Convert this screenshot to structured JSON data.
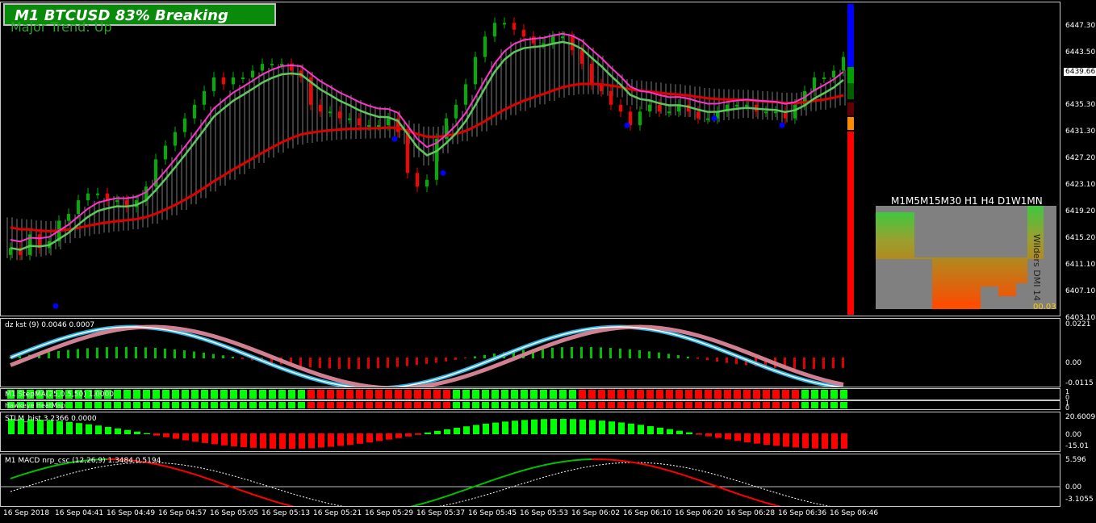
{
  "header": {
    "title": "M1 BTCUSD  83% Breaking",
    "subtitle": "Major Trend: Up"
  },
  "main_chart": {
    "price_ticks": [
      "6447.30",
      "6443.50",
      "6435.30",
      "6431.30",
      "6427.20",
      "6423.10",
      "6419.20",
      "6415.20",
      "6411.10",
      "6407.10",
      "6403.10"
    ],
    "current_price": "6439.66",
    "heatmap": {
      "header": "M1M5M15M30 H1 H4 D1W1MN",
      "side_label": "Wilders DMI 14",
      "value": "00.03"
    }
  },
  "panes": {
    "kst": {
      "label": "dz kst (9) 0.0046 0.0007",
      "ticks": [
        "0.0221",
        "0.00",
        "-0.0115"
      ]
    },
    "stepma": {
      "label": "M1 StepMA(25,0.5,50) 1.0000",
      "ticks": [
        "1",
        "0"
      ]
    },
    "heatmap_row": {
      "label": "Hawkeye HeatMap",
      "ticks": [
        "1",
        "0"
      ]
    },
    "stlm": {
      "label": "STLM_hist 3.2366 0.0000",
      "ticks": [
        "20.6009",
        "0.00",
        "-15.01"
      ]
    },
    "macd": {
      "label": "M1 MACD nrp_csc (12,26,9) 1.3484 0.5194",
      "ticks": [
        "5.596",
        "0.00",
        "-3.1055"
      ]
    }
  },
  "time_axis": [
    "16 Sep 2018",
    "16 Sep 04:41",
    "16 Sep 04:49",
    "16 Sep 04:57",
    "16 Sep 05:05",
    "16 Sep 05:13",
    "16 Sep 05:21",
    "16 Sep 05:29",
    "16 Sep 05:37",
    "16 Sep 05:45",
    "16 Sep 05:53",
    "16 Sep 06:02",
    "16 Sep 06:10",
    "16 Sep 06:20",
    "16 Sep 06:28",
    "16 Sep 06:36",
    "16 Sep 06:46"
  ],
  "chart_data": {
    "type": "candlestick",
    "symbol": "BTCUSD",
    "timeframe": "M1",
    "ylim": [
      6403.1,
      6449.0
    ],
    "close": [
      6413,
      6412,
      6415,
      6413,
      6414,
      6417,
      6418,
      6420,
      6421,
      6421,
      6420,
      6420,
      6419,
      6420,
      6422,
      6426,
      6428,
      6430,
      6432,
      6434,
      6436,
      6438,
      6437,
      6438,
      6438,
      6439,
      6440,
      6440,
      6440,
      6439,
      6438,
      6434,
      6433,
      6433,
      6432,
      6432,
      6431,
      6431,
      6431,
      6432,
      6430,
      6424,
      6422,
      6423,
      6429,
      6432,
      6434,
      6437,
      6441,
      6444,
      6446,
      6446,
      6445,
      6444,
      6443,
      6443,
      6444,
      6444,
      6442,
      6440,
      6437,
      6436,
      6434,
      6433,
      6431,
      6433,
      6434,
      6433,
      6433,
      6434,
      6433,
      6432,
      6432,
      6433,
      6434,
      6434,
      6434,
      6433,
      6433,
      6433,
      6432,
      6434,
      6436,
      6438,
      6438,
      6439,
      6441
    ],
    "colors": {
      "bull": "#00b000",
      "bear": "#ff0000",
      "ma_fast": "#5dc85d",
      "ma_slow": "#e00000",
      "signal": "#ff33cc"
    }
  }
}
